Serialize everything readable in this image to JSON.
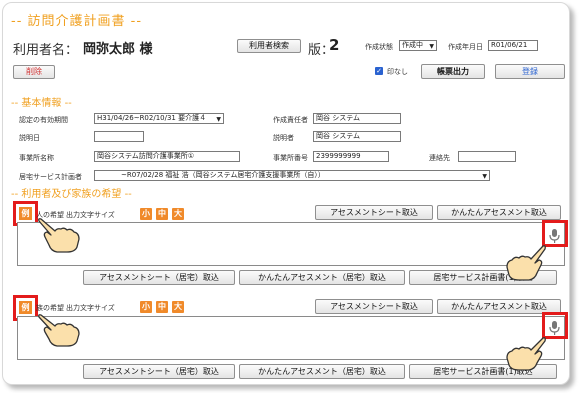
{
  "header": {
    "title": "-- 訪問介護計画書 --",
    "user_label": "利用者名：",
    "user_name": "岡弥太郎 様",
    "search_user_button": "利用者検索",
    "version_label": "版：",
    "version_number": "2",
    "status_label": "作成状態",
    "status_value": "作成中",
    "created_date_label": "作成年月日",
    "created_date_value": "R01/06/21",
    "delete_button": "削除",
    "print_checkbox_label": "印なし",
    "print_button": "帳票出力",
    "register_button": "登録"
  },
  "basic_info": {
    "section_title": "-- 基本情報 --",
    "cert_period_label": "認定の有効期間",
    "cert_period_value": "H31/04/26~R02/10/31 要介護４",
    "author_label": "作成責任者",
    "author_value": "岡谷 システム",
    "explain_date_label": "説明日",
    "explain_date_value": "",
    "explainer_label": "説明者",
    "explainer_value": "岡谷 システム",
    "office_name_label": "事業所名称",
    "office_name_value": "岡谷システム訪問介護事業所①",
    "office_number_label": "事業所番号",
    "office_number_value": "2399999999",
    "contact_label": "連絡先",
    "contact_value": "",
    "care_plan_label": "居宅サービス計画者",
    "care_plan_value": "~R07/02/28 福祉 浩（岡谷システム居宅介護支援事業所（自））"
  },
  "wishes": {
    "section_title": "-- 利用者及び家族の希望 --",
    "user_wish": {
      "example_button": "例",
      "label": "人の希望",
      "size_label": "出力文字サイズ",
      "size_small": "小",
      "size_medium": "中",
      "size_large": "大",
      "assessment_button": "アセスメントシート取込",
      "easy_assessment_button": "かんたんアセスメント取込",
      "text": ""
    },
    "user_wish_buttons": {
      "assessment_home": "アセスメントシート（居宅）取込",
      "easy_assessment_home": "かんたんアセスメント（居宅）取込",
      "home_service_plan": "居宅サービス計画書(1)取込"
    },
    "family_wish": {
      "example_button": "例",
      "label": "族の希望",
      "size_label": "出力文字サイズ",
      "size_small": "小",
      "size_medium": "中",
      "size_large": "大",
      "assessment_button": "アセスメントシート取込",
      "easy_assessment_button": "かんたんアセスメント取込",
      "text": ""
    },
    "family_wish_buttons": {
      "assessment_home": "アセスメントシート（居宅）取込",
      "easy_assessment_home": "かんたんアセスメント（居宅）取込",
      "home_service_plan": "居宅サービス計画書(1)取込"
    }
  },
  "colors": {
    "accent_orange": "#f0a020",
    "size_button_orange": "#f08a2a",
    "highlight_red": "#e31b1b",
    "delete_red": "#d03030",
    "register_blue": "#2a62d0"
  }
}
